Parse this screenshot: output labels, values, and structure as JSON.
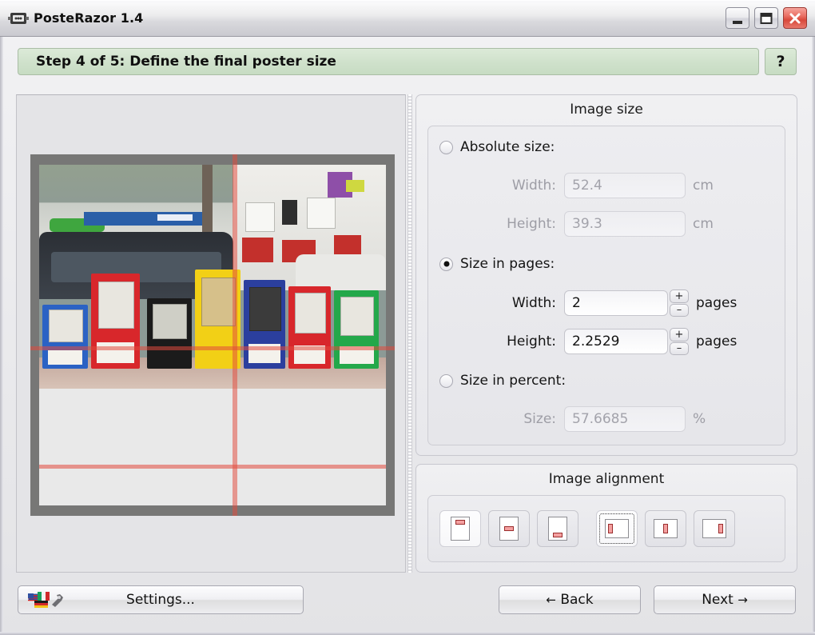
{
  "window": {
    "title": "PosteRazor 1.4",
    "app_icon": "posterazor-icon",
    "controls": {
      "minimize": "minimize-icon",
      "maximize": "maximize-icon",
      "close": "close-icon"
    }
  },
  "banner": {
    "step_text": "Step 4 of 5: Define the final poster size",
    "help_label": "?",
    "bg_color": "#cfe1cb"
  },
  "preview": {
    "name": "poster-preview",
    "guide_color": "#e24a3e",
    "canvas_color": "#777776",
    "paper_color": "#e9e9e9"
  },
  "image_size": {
    "group_title": "Image size",
    "absolute": {
      "radio_label": "Absolute size:",
      "selected": false,
      "width_label": "Width:",
      "width_value": "52.4",
      "width_unit": "cm",
      "height_label": "Height:",
      "height_value": "39.3",
      "height_unit": "cm"
    },
    "pages": {
      "radio_label": "Size in pages:",
      "selected": true,
      "width_label": "Width:",
      "width_value": "2",
      "width_unit": "pages",
      "height_label": "Height:",
      "height_value": "2.2529",
      "height_unit": "pages",
      "spin_up": "+",
      "spin_down": "–"
    },
    "percent": {
      "radio_label": "Size in percent:",
      "selected": false,
      "size_label": "Size:",
      "size_value": "57.6685",
      "size_unit": "%"
    }
  },
  "image_alignment": {
    "group_title": "Image alignment",
    "buttons": [
      {
        "name": "align-top",
        "selected": true,
        "focused": false
      },
      {
        "name": "align-middle",
        "selected": false,
        "focused": false
      },
      {
        "name": "align-bottom",
        "selected": false,
        "focused": false
      },
      {
        "name": "align-left",
        "selected": true,
        "focused": true
      },
      {
        "name": "align-center",
        "selected": false,
        "focused": false
      },
      {
        "name": "align-right",
        "selected": false,
        "focused": false
      }
    ]
  },
  "bottom_bar": {
    "settings_label": "Settings...",
    "settings_icon": "flags-and-tools-icon",
    "back_label": "Back",
    "back_arrow": "←",
    "next_label": "Next",
    "next_arrow": "→"
  }
}
